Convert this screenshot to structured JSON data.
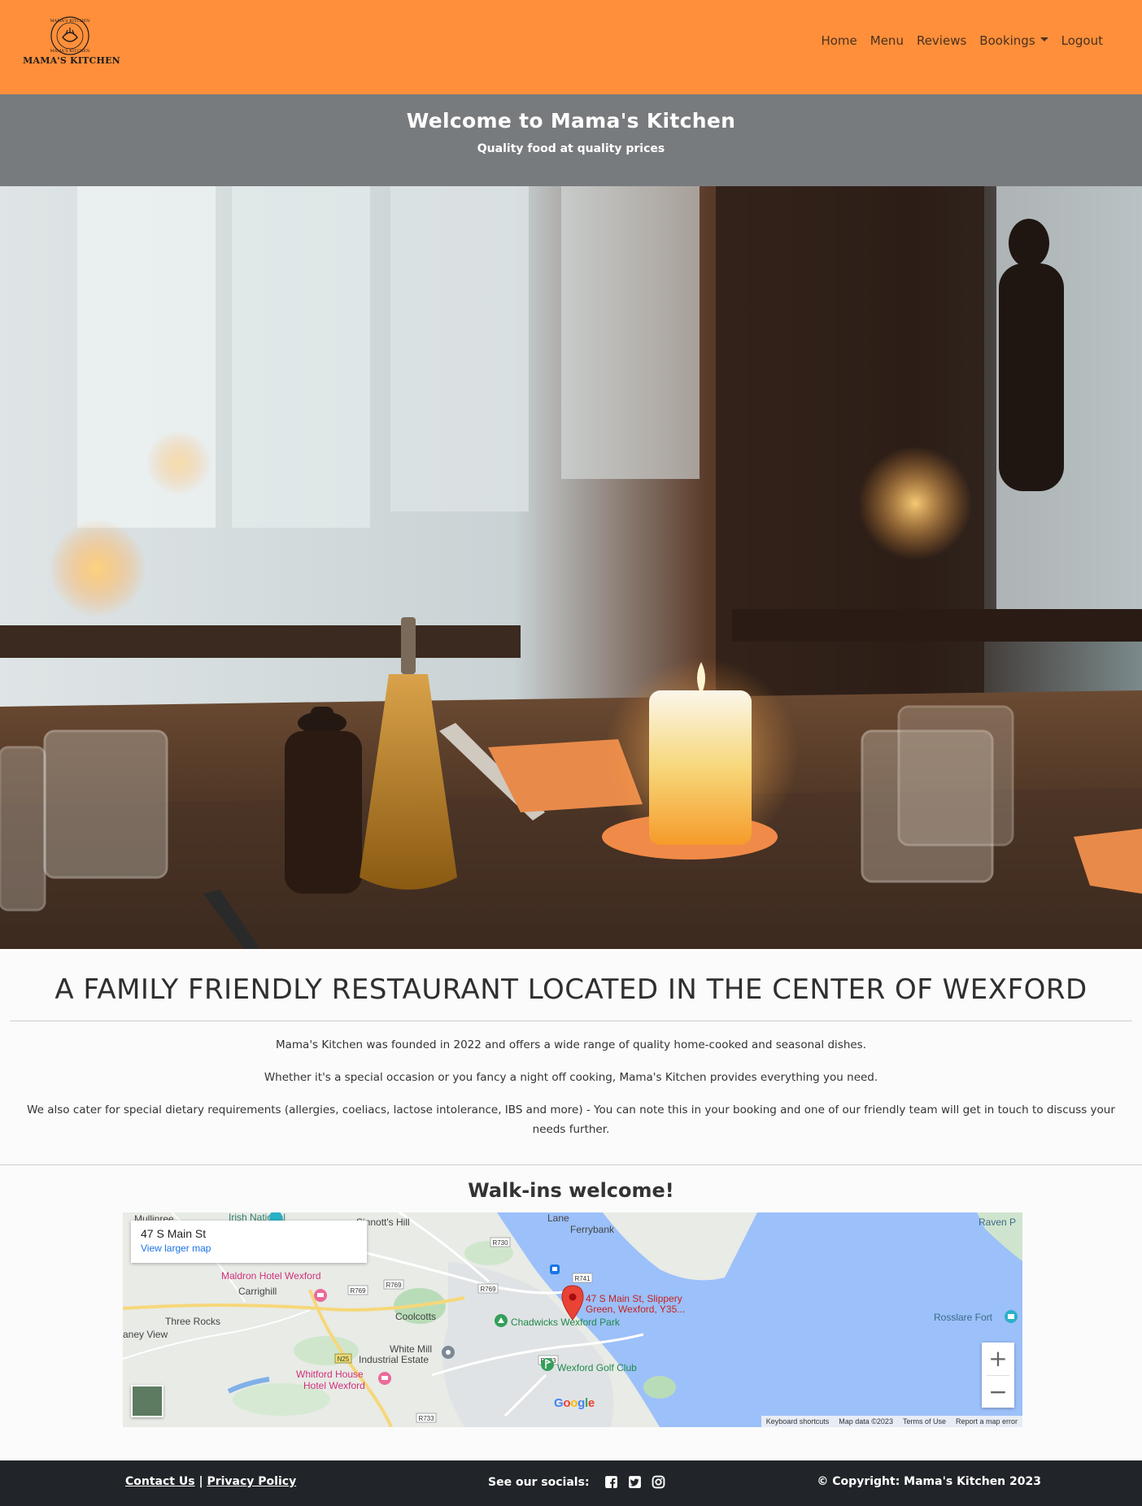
{
  "brand": {
    "logo_text": "MAMA'S KITCHEN",
    "logo_ring_text": "MAMA'S KITCHEN",
    "primary_color": "#ff8f3a"
  },
  "nav": {
    "items": [
      {
        "label": "Home"
      },
      {
        "label": "Menu"
      },
      {
        "label": "Reviews"
      },
      {
        "label": "Bookings",
        "dropdown": true
      },
      {
        "label": "Logout"
      }
    ]
  },
  "banner": {
    "title": "Welcome to Mama's Kitchen",
    "subtitle": "Quality food at quality prices",
    "background": "#787b7e"
  },
  "about": {
    "heading": "A FAMILY FRIENDLY RESTAURANT LOCATED IN THE CENTER OF WEXFORD",
    "paragraphs": [
      "Mama's Kitchen was founded in 2022 and offers a wide range of quality home-cooked and seasonal dishes.",
      "Whether it's a special occasion or you fancy a night off cooking, Mama's Kitchen provides everything you need.",
      "We also cater for special dietary requirements (allergies, coeliacs, lactose intolerance, IBS and more) - You can note this in your booking and one of our friendly team will get in touch to discuss your needs further."
    ]
  },
  "walkins": {
    "title": "Walk-ins welcome!"
  },
  "map": {
    "card_address": "47 S Main St",
    "card_link": "View larger map",
    "marker_label_line1": "47 S Main St, Slippery",
    "marker_label_line2": "Green, Wexford, Y35...",
    "places": {
      "mullinree": "Mullinree",
      "irish_national": "Irish National",
      "sinnotts_hill": "Sinnott's Hill",
      "lane": "Lane",
      "ferrybank": "Ferrybank",
      "raven_point": "Raven P",
      "maldron": "Maldron Hotel Wexford",
      "carrighill": "Carrighill",
      "three_rocks": "Three Rocks",
      "coolcotts": "Coolcotts",
      "chadwicks": "Chadwicks Wexford Park",
      "rosslare_fort": "Rosslare Fort",
      "laney_view": "aney View",
      "white_mill_1": "White Mill",
      "white_mill_2": "Industrial Estate",
      "whitford_1": "Whitford House",
      "whitford_2": "Hotel Wexford",
      "golf_club": "Wexford Golf Club"
    },
    "roads": {
      "r730": "R730",
      "r741": "R741",
      "r769a": "R769",
      "r769b": "R769",
      "r769c": "R769",
      "r733a": "R733",
      "r733b": "R733",
      "n25": "N25"
    },
    "zoom_in": "+",
    "zoom_out": "−",
    "attribution": [
      "Keyboard shortcuts",
      "Map data ©2023",
      "Terms of Use",
      "Report a map error"
    ],
    "google": "Google",
    "water_color": "#9cc0f9",
    "land_color": "#e8ebe6"
  },
  "footer": {
    "contact": "Contact Us",
    "separator": "|",
    "privacy": "Privacy Policy",
    "socials_label": "See our socials:",
    "social_icons": [
      "facebook-icon",
      "twitter-icon",
      "instagram-icon"
    ],
    "copyright": "© Copyright: Mama's Kitchen 2023"
  }
}
